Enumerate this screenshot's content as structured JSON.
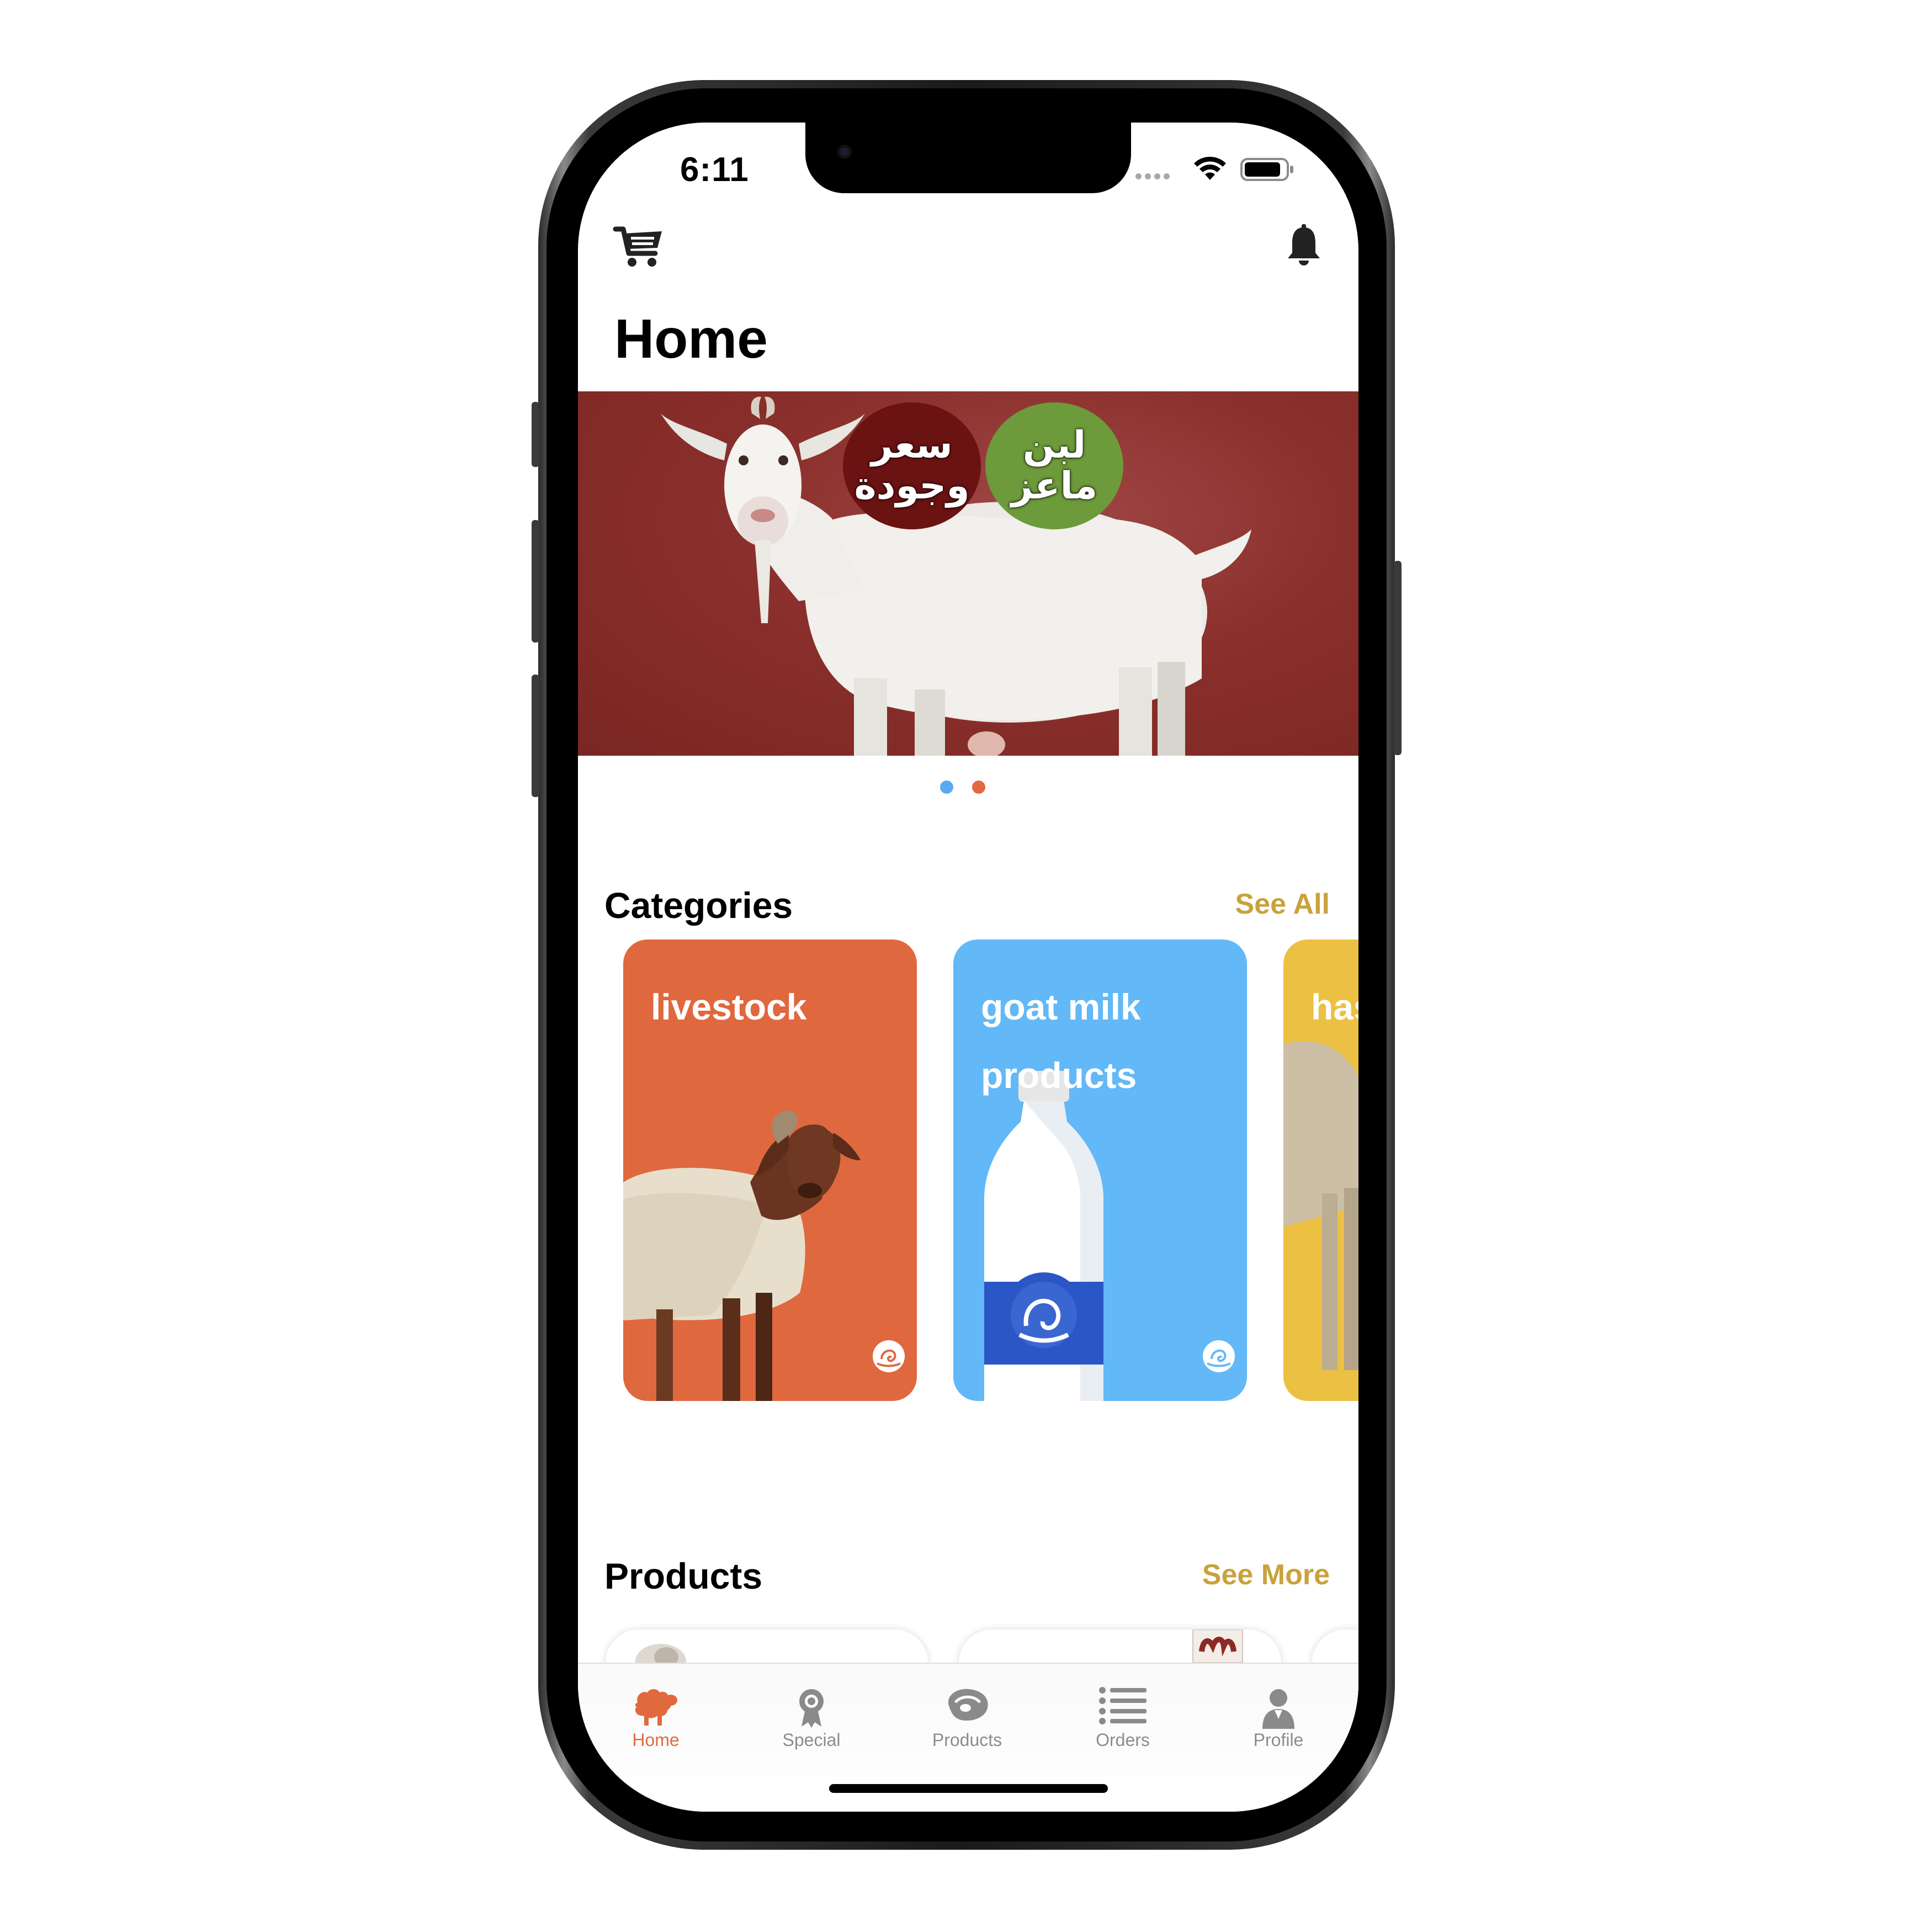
{
  "status_bar": {
    "time": "6:11"
  },
  "header": {
    "title": "Home"
  },
  "banner": {
    "badge_left": "سعر وجودة",
    "badge_right": "لبن ماعز",
    "pagination": {
      "active_index": 0,
      "count": 2
    }
  },
  "categories": {
    "title": "Categories",
    "see_all": "See All",
    "items": [
      {
        "label": "livestock",
        "color": "#e0683f"
      },
      {
        "label": "goat milk products",
        "color": "#63b8f7"
      },
      {
        "label": "has",
        "color": "#ecc043"
      }
    ]
  },
  "products": {
    "title": "Products",
    "see_more": "See More"
  },
  "tab_bar": {
    "items": [
      {
        "label": "Home",
        "icon": "sheep-icon",
        "active": true
      },
      {
        "label": "Special",
        "icon": "award-icon",
        "active": false
      },
      {
        "label": "Products",
        "icon": "meat-icon",
        "active": false
      },
      {
        "label": "Orders",
        "icon": "list-icon",
        "active": false
      },
      {
        "label": "Profile",
        "icon": "user-icon",
        "active": false
      }
    ]
  },
  "colors": {
    "accent_gold": "#c9a23c",
    "active_tab": "#e06a3e",
    "dot_active": "#5aaaf0",
    "dot_inactive": "#e3683f"
  }
}
